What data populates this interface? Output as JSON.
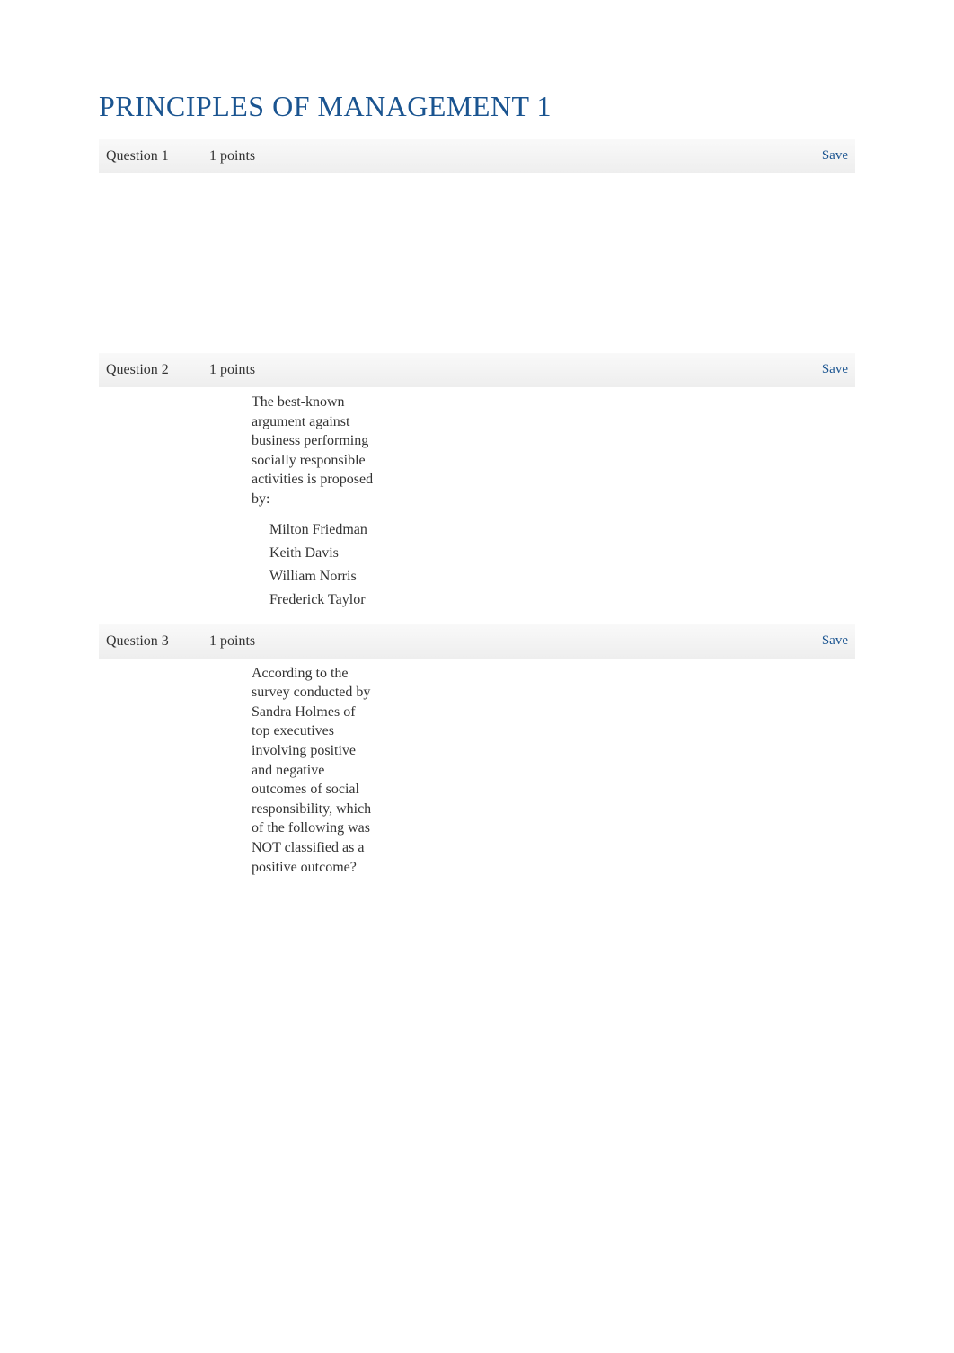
{
  "title": "PRINCIPLES OF MANAGEMENT 1",
  "questions": [
    {
      "label": "Question 1",
      "points": "1 points",
      "save": "Save",
      "text": "",
      "options": []
    },
    {
      "label": "Question 2",
      "points": "1 points",
      "save": "Save",
      "text": "The best-known argument against business performing socially responsible activities is proposed by:",
      "options": [
        "Milton Friedman",
        "Keith Davis",
        "William Norris",
        "Frederick Taylor"
      ]
    },
    {
      "label": "Question 3",
      "points": "1 points",
      "save": "Save",
      "text": "According to the survey conducted by Sandra Holmes of top executives involving positive and negative outcomes of social responsibility, which of the following was NOT classified as a positive outcome?",
      "options": []
    }
  ]
}
